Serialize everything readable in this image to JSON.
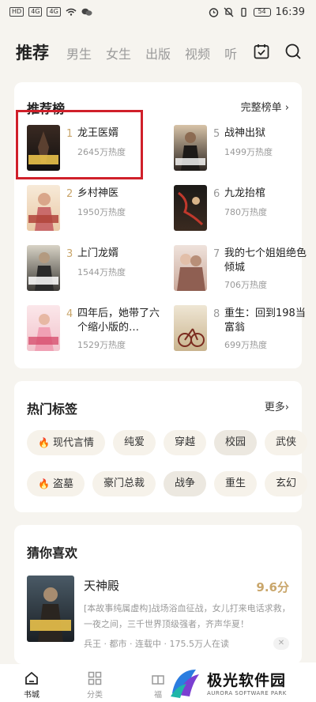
{
  "status_bar": {
    "left_chips": [
      "HD",
      "4G",
      "4G"
    ],
    "battery": "54",
    "time": "16:39"
  },
  "top_nav": {
    "tabs": [
      "推荐",
      "男生",
      "女生",
      "出版",
      "视频",
      "听"
    ],
    "icons": [
      "calendar-check-icon",
      "search-icon"
    ]
  },
  "ranking": {
    "title": "推荐榜",
    "more": "完整榜单 ›",
    "items": [
      {
        "rank": "1",
        "name": "龙王医婿",
        "heat": "2645万热度",
        "cover_text": "龙王医婿"
      },
      {
        "rank": "2",
        "name": "乡村神医",
        "heat": "1950万热度",
        "cover_text": "乡村神医"
      },
      {
        "rank": "3",
        "name": "上门龙婿",
        "heat": "1544万热度",
        "cover_text": "上门龙婿"
      },
      {
        "rank": "4",
        "name": "四年后，她带了六个缩小版的…",
        "heat": "1529万热度",
        "cover_text": "缩小版的"
      },
      {
        "rank": "5",
        "name": "战神出狱",
        "heat": "1499万热度",
        "cover_text": "战神出狱"
      },
      {
        "rank": "6",
        "name": "九龙抬棺",
        "heat": "780万热度",
        "cover_text": "九龙抬棺"
      },
      {
        "rank": "7",
        "name": "我的七个姐姐绝色倾城",
        "heat": "706万热度",
        "cover_text": ""
      },
      {
        "rank": "8",
        "name": "重生：回到198当富翁",
        "heat": "699万热度",
        "cover_text": ""
      }
    ]
  },
  "tags": {
    "title": "热门标签",
    "more": "更多›",
    "row1": [
      "现代言情",
      "纯爱",
      "穿越",
      "校园",
      "武侠"
    ],
    "row2": [
      "盗墓",
      "豪门总裁",
      "战争",
      "重生",
      "玄幻"
    ]
  },
  "guess": {
    "title": "猜你喜欢",
    "name": "天神殿",
    "score": "9.6分",
    "desc": "[本故事纯属虚构]战场浴血征战，女儿打来电话求救，一夜之间，三千世界顶级强者，齐声华夏！",
    "meta": "兵王 · 都市 · 连载中 · 175.5万人在读",
    "cover_text": "天神殿",
    "close": "✕"
  },
  "bottom_bar": {
    "items": [
      {
        "label": "书城",
        "icon": "bookstore-icon"
      },
      {
        "label": "分类",
        "icon": "category-icon"
      },
      {
        "label": "福",
        "icon": "welfare-icon"
      }
    ]
  },
  "watermark": {
    "cn": "极光软件园",
    "en": "AURORA SOFTWARE PARK"
  },
  "colors": {
    "accent_gold": "#c9a66b",
    "highlight_red": "#d0202a",
    "flame_orange": "#e0622c"
  }
}
